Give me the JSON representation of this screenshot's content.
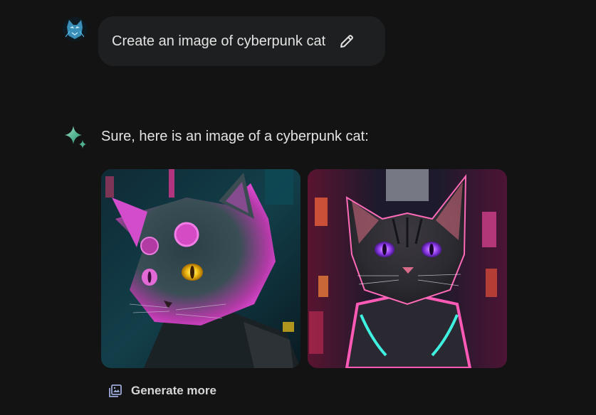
{
  "user_prompt": {
    "text": "Create an image of cyberpunk cat",
    "edit_icon": "pencil-icon"
  },
  "response": {
    "text": "Sure, here is an image of a cyberpunk cat:",
    "assistant_icon": "sparkle-icon"
  },
  "images": [
    {
      "name": "cyberpunk-cat-image-1",
      "accent": "#e24ad8",
      "eye_color": "#f5c518"
    },
    {
      "name": "cyberpunk-cat-image-2",
      "accent": "#ff4fa8",
      "eye_color": "#a24bff"
    }
  ],
  "actions": {
    "generate_more_label": "Generate more",
    "generate_more_icon": "image-stack-icon"
  }
}
